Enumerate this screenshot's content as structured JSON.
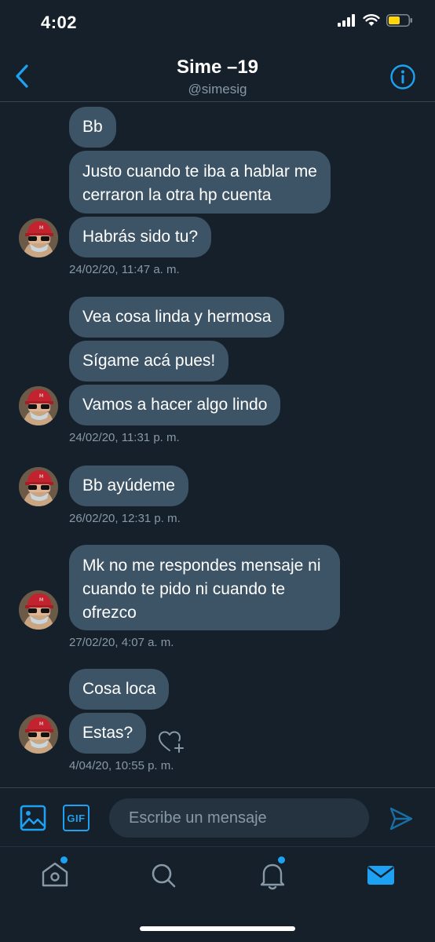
{
  "status_bar": {
    "time": "4:02"
  },
  "header": {
    "name": "Sime –19",
    "handle": "@simesig"
  },
  "messages": [
    {
      "text": "Bb"
    },
    {
      "text": "Justo cuando te iba a hablar me cerraron la otra hp cuenta"
    },
    {
      "text": "Habrás sido tu?"
    },
    {
      "text": "Vea cosa linda y hermosa"
    },
    {
      "text": "Sígame acá pues!"
    },
    {
      "text": "Vamos a hacer algo lindo"
    },
    {
      "text": "Bb ayúdeme"
    },
    {
      "text": "Mk no me respondes mensaje ni cuando te pido ni cuando te ofrezco"
    },
    {
      "text": "Cosa loca"
    },
    {
      "text": "Estas?"
    }
  ],
  "timestamps": [
    "24/02/20, 11:47 a. m.",
    "24/02/20, 11:31 p. m.",
    "26/02/20, 12:31 p. m.",
    "27/02/20, 4:07 a. m.",
    "4/04/20, 10:55 p. m."
  ],
  "composer": {
    "placeholder": "Escribe un mensaje",
    "gif_label": "GIF"
  },
  "colors": {
    "background": "#15202b",
    "bubble": "#3d5466",
    "accent": "#1da1f2",
    "muted_text": "#8899a6",
    "divider": "#38444d"
  },
  "icons": {
    "header": [
      "back-arrow-icon",
      "info-icon"
    ],
    "composer": [
      "image-icon",
      "gif-icon",
      "send-icon"
    ],
    "tabbar": [
      "home-icon",
      "search-icon",
      "notifications-icon",
      "messages-icon"
    ],
    "message": [
      "add-reaction-heart-icon"
    ]
  }
}
